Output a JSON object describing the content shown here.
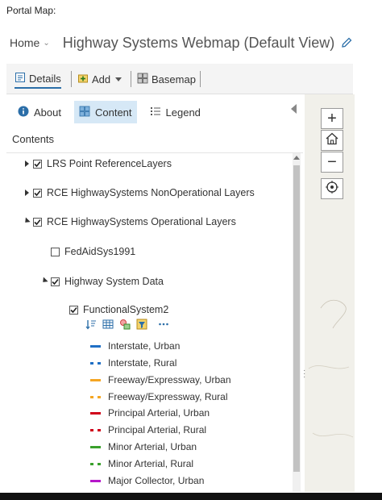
{
  "caption": "Portal Map:",
  "header": {
    "home_label": "Home",
    "map_title": "Highway Systems Webmap (Default View)"
  },
  "toolbar": {
    "details": "Details",
    "add": "Add",
    "basemap": "Basemap"
  },
  "tabs": {
    "about": "About",
    "content": "Content",
    "legend": "Legend"
  },
  "contents_label": "Contents",
  "layers": [
    {
      "label": "LRS Point ReferenceLayers",
      "expanded": false,
      "checked": true
    },
    {
      "label": "RCE HighwaySystems NonOperational Layers",
      "expanded": false,
      "checked": true
    },
    {
      "label": "RCE HighwaySystems Operational Layers",
      "expanded": true,
      "checked": true
    },
    {
      "label": "FedAidSys1991",
      "checked": false
    },
    {
      "label": "Highway System Data",
      "expanded": true,
      "checked": true
    },
    {
      "label": "FunctionalSystem2",
      "checked": true
    }
  ],
  "legend": [
    {
      "label": "Interstate, Urban",
      "color": "#1f6fc5",
      "style": "solid"
    },
    {
      "label": "Interstate, Rural",
      "color": "#1f6fc5",
      "style": "dashed"
    },
    {
      "label": "Freeway/Expressway, Urban",
      "color": "#f5a623",
      "style": "solid"
    },
    {
      "label": "Freeway/Expressway, Rural",
      "color": "#f5a623",
      "style": "dashed"
    },
    {
      "label": "Principal Arterial, Urban",
      "color": "#d0021b",
      "style": "solid"
    },
    {
      "label": "Principal Arterial, Rural",
      "color": "#d0021b",
      "style": "dashed"
    },
    {
      "label": "Minor Arterial, Urban",
      "color": "#3aa02c",
      "style": "solid"
    },
    {
      "label": "Minor Arterial, Rural",
      "color": "#3aa02c",
      "style": "dashed"
    },
    {
      "label": "Major Collector, Urban",
      "color": "#b517c9",
      "style": "solid"
    }
  ],
  "map_controls": {
    "zoom_in": "+",
    "zoom_out": "−"
  },
  "colors": {
    "accent": "#2b6ea8",
    "tab_active_bg": "#d6e8f6"
  }
}
